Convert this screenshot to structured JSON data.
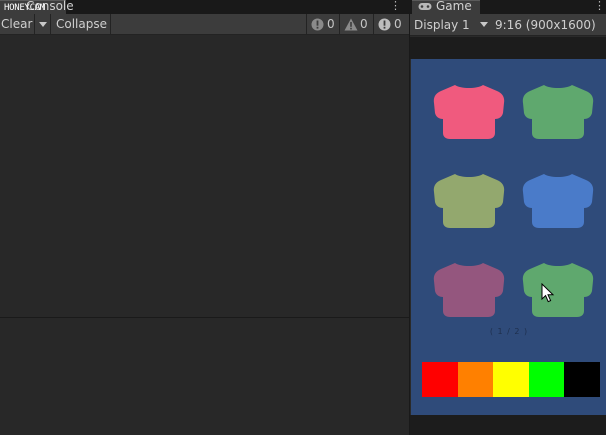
{
  "console": {
    "tab_title": "Console",
    "watermark": "HONEYCAM",
    "toolbar": {
      "clear_label": "Clear",
      "collapse_label": "Collapse",
      "info_count": "0",
      "warning_count": "0",
      "error_count": "0"
    }
  },
  "game": {
    "tab_title": "Game",
    "display_label": "Display 1",
    "resolution_label": "9:16 (900x1600)",
    "page_indicator": "( 1 / 2 )",
    "shirts": [
      {
        "color": "#f05a7e"
      },
      {
        "color": "#5fa86e"
      },
      {
        "color": "#93a86e"
      },
      {
        "color": "#4a7bc9"
      },
      {
        "color": "#94567e"
      },
      {
        "color": "#5fa86e"
      }
    ],
    "swatches": [
      "#ff0000",
      "#ff8000",
      "#ffff00",
      "#00ff00",
      "#000000"
    ],
    "viewport_bg": "#2f4b7a"
  }
}
